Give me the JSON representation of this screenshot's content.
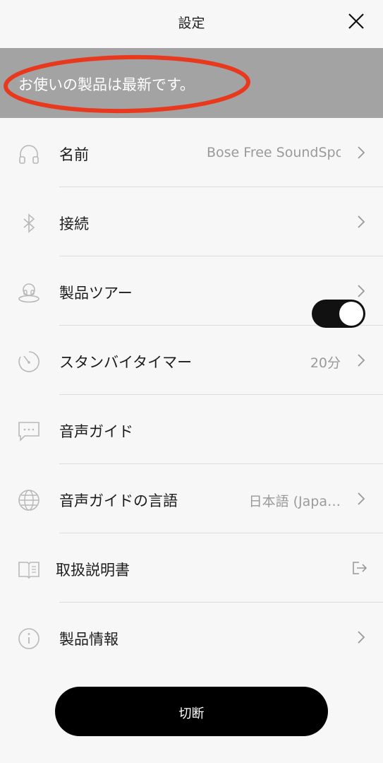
{
  "header": {
    "title": "設定"
  },
  "banner": {
    "text": "お使いの製品は最新です。"
  },
  "settings": {
    "items": [
      {
        "label": "名前",
        "value": "Bose Free SoundSport",
        "icon": "headphones-icon",
        "trail": "chevron"
      },
      {
        "label": "接続",
        "value": "",
        "icon": "bluetooth-icon",
        "trail": "chevron"
      },
      {
        "label": "製品ツアー",
        "value": "",
        "icon": "earbud-tour-icon",
        "trail": "chevron"
      },
      {
        "label": "スタンバイタイマー",
        "value": "20分",
        "icon": "timer-icon",
        "trail": "chevron"
      },
      {
        "label": "音声ガイド",
        "value": "",
        "icon": "speech-bubble-icon",
        "trail": "toggle",
        "toggle_on": true
      },
      {
        "label": "音声ガイドの言語",
        "value": "日本語 (Japa…",
        "icon": "globe-icon",
        "trail": "chevron"
      },
      {
        "label": "取扱説明書",
        "value": "",
        "icon": "book-icon",
        "trail": "external-link"
      },
      {
        "label": "製品情報",
        "value": "",
        "icon": "info-icon",
        "trail": "chevron"
      }
    ]
  },
  "footer": {
    "disconnect_label": "切断"
  },
  "colors": {
    "banner": "#a3a3a3",
    "annotation": "#e8391e",
    "toggle_on": "#111111"
  }
}
